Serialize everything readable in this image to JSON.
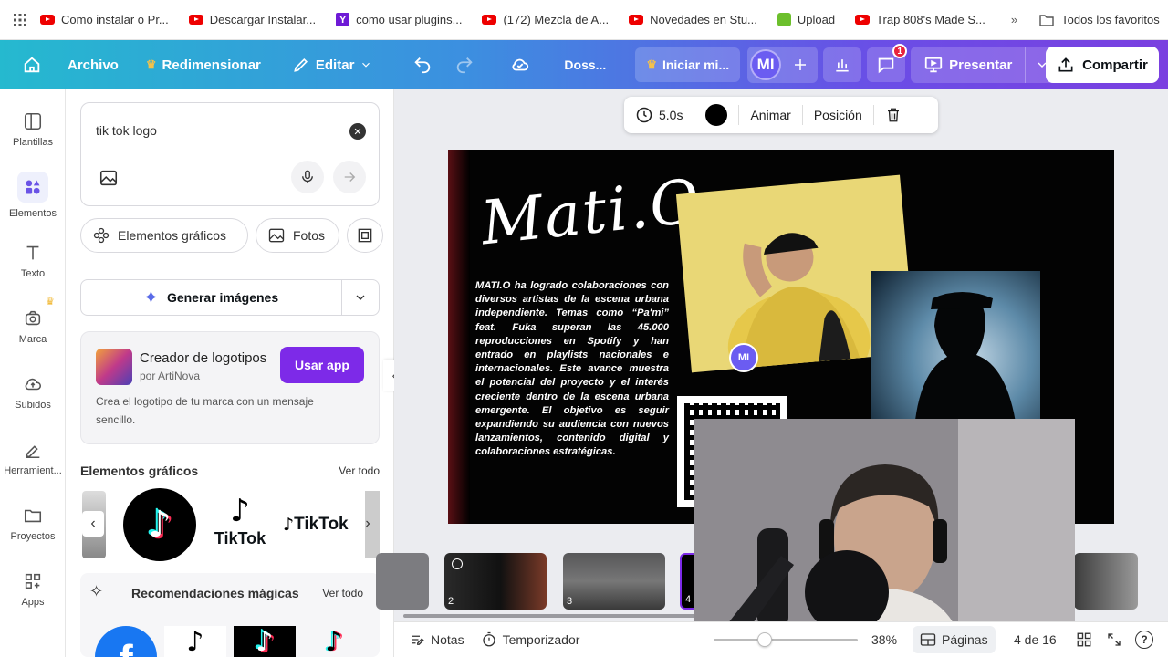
{
  "bookmarks": {
    "items": [
      {
        "label": "Como instalar o Pr...",
        "icon": "youtube-icon"
      },
      {
        "label": "Descargar Instalar...",
        "icon": "youtube-icon"
      },
      {
        "label": "como usar plugins...",
        "icon": "yahoo-icon"
      },
      {
        "label": "(172) Mezcla de A...",
        "icon": "youtube-icon"
      },
      {
        "label": "Novedades en Stu...",
        "icon": "youtube-icon"
      },
      {
        "label": "Upload",
        "icon": "upload-site-icon"
      },
      {
        "label": "Trap 808's Made S...",
        "icon": "youtube-icon"
      }
    ],
    "favorites": "Todos los favoritos"
  },
  "header": {
    "archivo": "Archivo",
    "redimensionar": "Redimensionar",
    "editar": "Editar",
    "doc_title": "Doss...",
    "trial": "Iniciar mi...",
    "avatar": "MI",
    "comments_badge": "1",
    "presentar": "Presentar",
    "compartir": "Compartir"
  },
  "rail": {
    "plantillas": "Plantillas",
    "elementos": "Elementos",
    "texto": "Texto",
    "marca": "Marca",
    "subidos": "Subidos",
    "herramientas": "Herramient...",
    "proyectos": "Proyectos",
    "apps": "Apps"
  },
  "panel": {
    "search_value": "tik tok logo",
    "chips": {
      "graficos": "Elementos gráficos",
      "fotos": "Fotos"
    },
    "generar": "Generar imágenes",
    "promo": {
      "title": "Creador de logotipos",
      "by": "por ArtiNova",
      "button": "Usar app",
      "desc1": "Crea el logotipo de tu marca con un mensaje",
      "desc2": "sencillo."
    },
    "graficos_title": "Elementos gráficos",
    "ver_todo": "Ver todo",
    "tiktok_word": "TikTok",
    "magic_title": "Recomendaciones mágicas",
    "magic_ver_todo": "Ver todo"
  },
  "canvas_toolbar": {
    "duration": "5.0s",
    "animar": "Animar",
    "posicion": "Posición"
  },
  "slide": {
    "signature": "Mati.O",
    "bio": "MATI.O ha logrado colaboraciones con diversos artistas de la escena urbana independiente. Temas como “Pa'mi” feat. Fuka superan las 45.000 reproducciones en Spotify y han entrado en playlists nacionales e internacionales. Este avance muestra el potencial del proyecto y el interés creciente dentro de la escena urbana emergente. El objetivo es seguir expandiendo su audiencia con nuevos lanzamientos, contenido digital y colaboraciones estratégicas.",
    "avatar_badge": "MI"
  },
  "thumbs": {
    "n2": "2",
    "n3": "3",
    "n4": "4"
  },
  "bottom": {
    "notas": "Notas",
    "temporizador": "Temporizador",
    "zoom": "38%",
    "paginas": "Páginas",
    "page_count": "4 de 16"
  }
}
